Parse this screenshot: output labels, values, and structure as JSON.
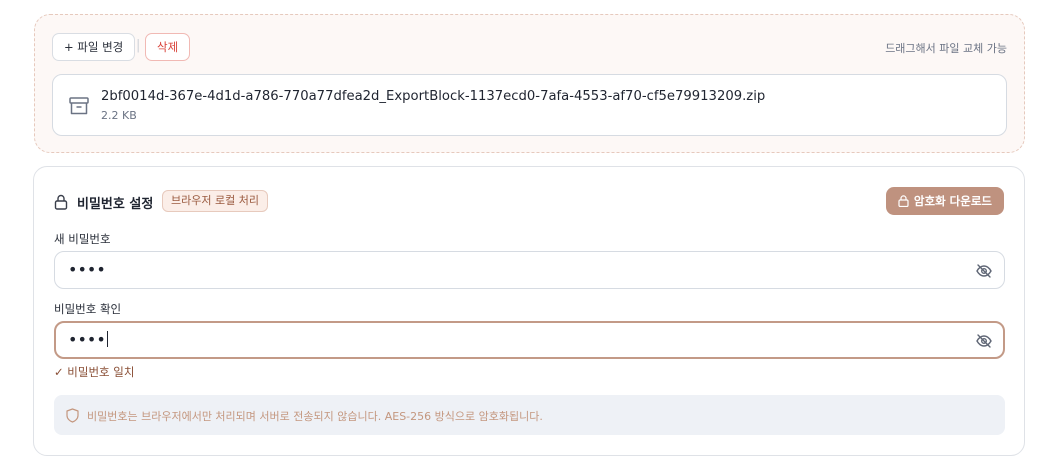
{
  "upload": {
    "change_label": "+ 파일 변경",
    "separator": "|",
    "delete_label": "삭제",
    "drag_hint": "드래그해서 파일 교체 가능",
    "file": {
      "name": "2bf0014d-367e-4d1d-a786-770a77dfea2d_ExportBlock-1137ecd0-7afa-4553-af70-cf5e79913209.zip",
      "size": "2.2 KB",
      "icon": "archive-icon"
    }
  },
  "password": {
    "title": "비밀번호 설정",
    "badge": "브라우저 로컬 처리",
    "encrypt_button": "암호화 다운로드",
    "new_label": "새 비밀번호",
    "new_value": "••••",
    "confirm_label": "비밀번호 확인",
    "confirm_value": "••••",
    "match_message": "✓ 비밀번호 일치",
    "notice": "비밀번호는 브라우저에서만 처리되며 서버로 전송되지 않습니다. AES-256 방식으로 암호화됩니다."
  },
  "colors": {
    "accent": "#bf927f",
    "danger": "#d9443b",
    "focus_border": "#c39a87",
    "notice_bg": "#eef1f6"
  }
}
